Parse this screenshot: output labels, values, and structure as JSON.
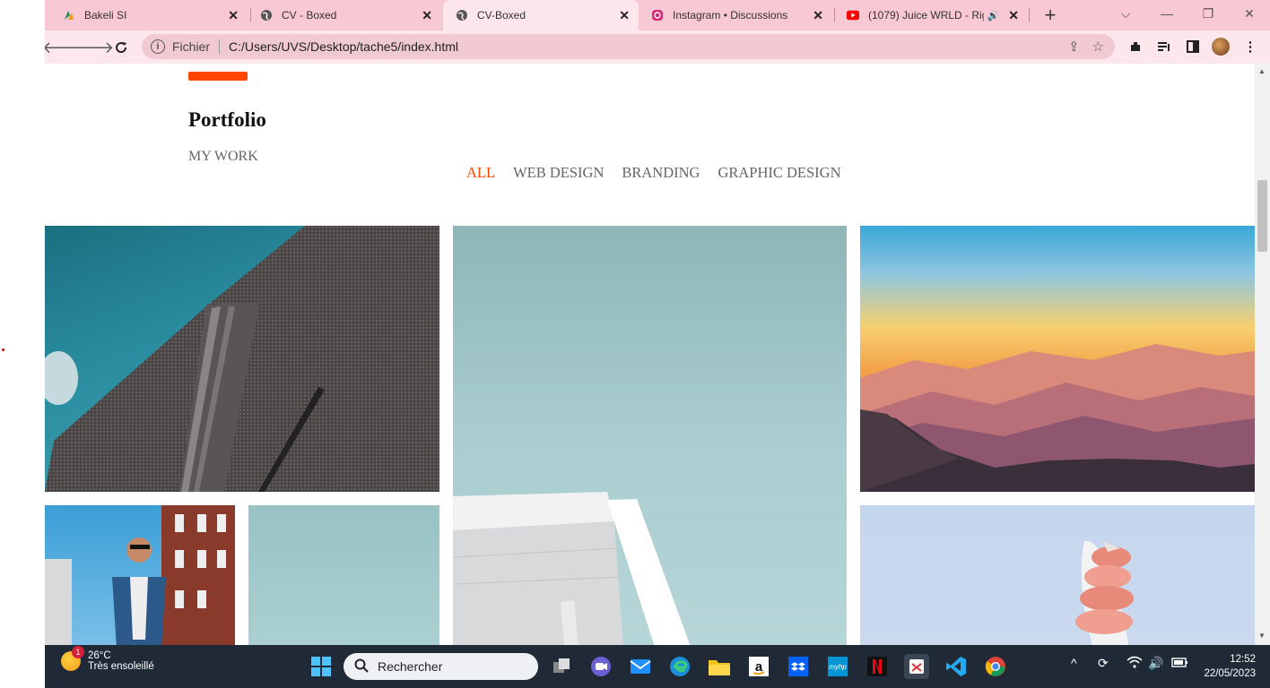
{
  "tabs": [
    {
      "title": "Bakeli SI",
      "close": "✕"
    },
    {
      "title": "CV - Boxed",
      "close": "✕"
    },
    {
      "title": "CV-Boxed",
      "close": "✕"
    },
    {
      "title": "Instagram • Discussions",
      "close": "✕"
    },
    {
      "title": "(1079) Juice WRLD - Rig",
      "close": "✕"
    }
  ],
  "toolbar": {
    "scheme": "Fichier",
    "url": "C:/Users/UVS/Desktop/tache5/index.html"
  },
  "page": {
    "title": "Portfolio",
    "subtitle": "MY WORK",
    "filters": [
      "ALL",
      "WEB DESIGN",
      "BRANDING",
      "GRAPHIC DESIGN"
    ],
    "active_filter": "ALL",
    "accent_color": "#ff4500"
  },
  "taskbar": {
    "temperature": "26°C",
    "weather": "Très ensoleillé",
    "weather_badge": "1",
    "search_placeholder": "Rechercher",
    "time": "12:52",
    "date": "22/05/2023"
  }
}
